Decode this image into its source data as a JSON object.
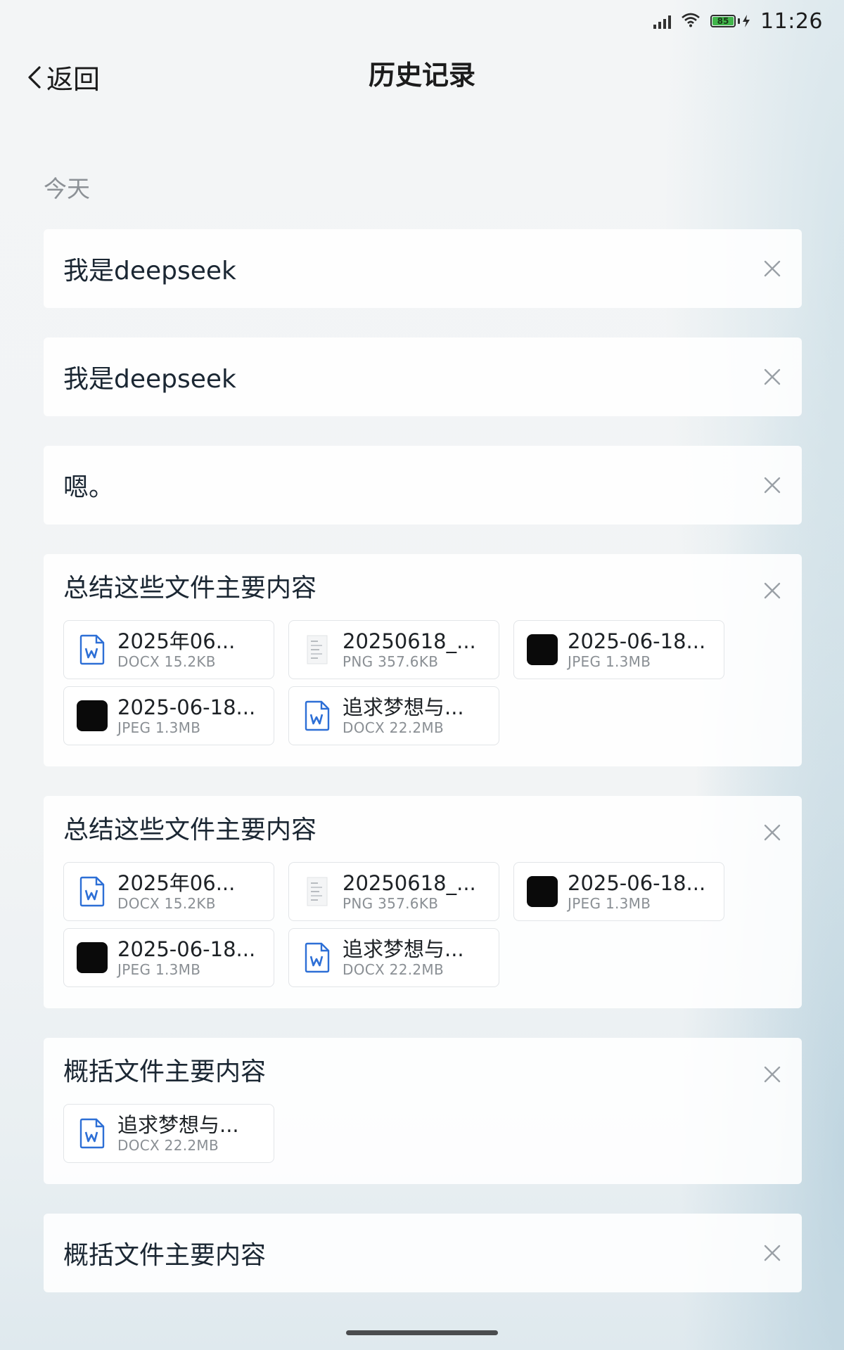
{
  "status": {
    "time": "11:26",
    "battery": "85"
  },
  "header": {
    "back_label": "返回",
    "title": "历史记录"
  },
  "section": {
    "label": "今天"
  },
  "history": [
    {
      "text": "我是deepseek",
      "files": []
    },
    {
      "text": "我是deepseek",
      "files": []
    },
    {
      "text": "嗯。",
      "files": []
    },
    {
      "text": "总结这些文件主要内容",
      "files": [
        {
          "name": "2025年06...",
          "meta": "DOCX 15.2KB",
          "icon": "word-doc-icon"
        },
        {
          "name": "20250618_...",
          "meta": "PNG 357.6KB",
          "icon": "image-thumbnail-icon"
        },
        {
          "name": "2025-06-18...",
          "meta": "JPEG 1.3MB",
          "icon": "black-image-thumbnail"
        },
        {
          "name": "2025-06-18...",
          "meta": "JPEG 1.3MB",
          "icon": "black-image-thumbnail"
        },
        {
          "name": "追求梦想与...",
          "meta": "DOCX 22.2MB",
          "icon": "word-doc-icon"
        }
      ]
    },
    {
      "text": "总结这些文件主要内容",
      "files": [
        {
          "name": "2025年06...",
          "meta": "DOCX 15.2KB",
          "icon": "word-doc-icon"
        },
        {
          "name": "20250618_...",
          "meta": "PNG 357.6KB",
          "icon": "image-thumbnail-icon"
        },
        {
          "name": "2025-06-18...",
          "meta": "JPEG 1.3MB",
          "icon": "black-image-thumbnail"
        },
        {
          "name": "2025-06-18...",
          "meta": "JPEG 1.3MB",
          "icon": "black-image-thumbnail"
        },
        {
          "name": "追求梦想与...",
          "meta": "DOCX 22.2MB",
          "icon": "word-doc-icon"
        }
      ]
    },
    {
      "text": "概括文件主要内容",
      "files": [
        {
          "name": "追求梦想与...",
          "meta": "DOCX 22.2MB",
          "icon": "word-doc-icon"
        }
      ]
    },
    {
      "text": "概括文件主要内容",
      "files": []
    }
  ],
  "colors": {
    "doc_icon": "#2d6fd6",
    "card_bg": "#ffffff",
    "muted": "#8c9196"
  }
}
